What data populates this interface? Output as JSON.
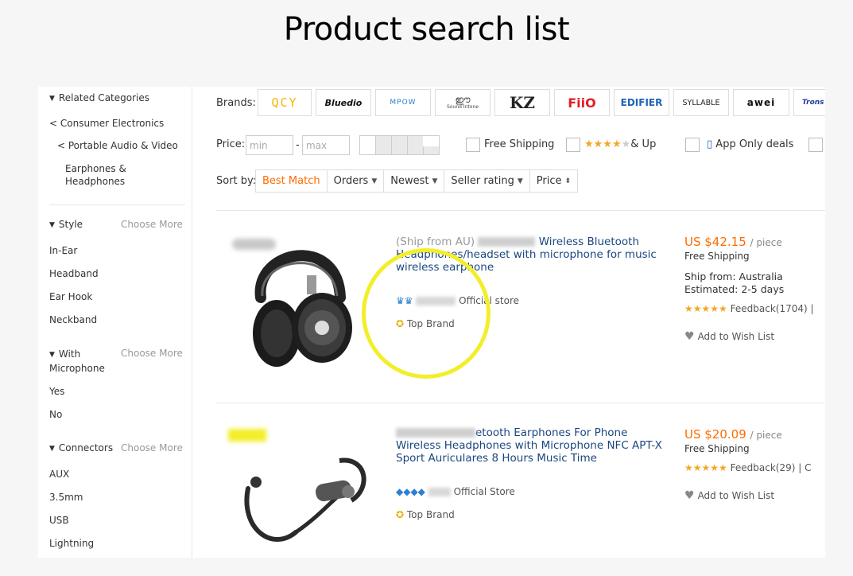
{
  "page_title": "Product search list",
  "sidebar": {
    "related_categories_heading": "Related Categories",
    "breadcrumb": [
      "< Consumer Electronics",
      "< Portable Audio & Video"
    ],
    "current_category": "Earphones & Headphones",
    "filter_groups": [
      {
        "title": "Style",
        "more": "Choose More",
        "options": [
          "In-Ear",
          "Headband",
          "Ear Hook",
          "Neckband"
        ]
      },
      {
        "title": "With Microphone",
        "more": "Choose More",
        "options": [
          "Yes",
          "No"
        ]
      },
      {
        "title": "Connectors",
        "more": "Choose More",
        "options": [
          "AUX",
          "3.5mm",
          "USB",
          "Lightning"
        ]
      }
    ]
  },
  "filters": {
    "brands_label": "Brands:",
    "brands": [
      "QCY",
      "Bluedio",
      "MPOW",
      "Sound Intone",
      "KZ",
      "FiiO",
      "EDIFIER",
      "SYLLABLE",
      "awei",
      "Trons"
    ],
    "price_label": "Price:",
    "price_min_placeholder": "min",
    "price_max_placeholder": "max",
    "price_sep": "-",
    "free_shipping": "Free Shipping",
    "rating_and_up": "& Up",
    "app_only": "App Only deals"
  },
  "sort": {
    "label": "Sort by:",
    "options": [
      "Best Match",
      "Orders",
      "Newest",
      "Seller rating",
      "Price"
    ],
    "active": "Best Match"
  },
  "products": [
    {
      "ship_prefix": "(Ship from AU)",
      "title_rest": "Wireless Bluetooth Headphones/headset with microphone for music wireless earphone",
      "store": "Official store",
      "badge": "Top Brand",
      "price": "US $42.15",
      "price_unit": "/ piece",
      "shipping": "Free Shipping",
      "ship_from": "Ship from: Australia",
      "estimated": "Estimated: 2-5 days",
      "feedback": "Feedback(1704)",
      "wish": "Add to Wish List"
    },
    {
      "title_rest": "etooth Earphones For Phone Wireless Headphones with Microphone NFC APT-X Sport Auriculares 8 Hours Music Time",
      "store": "Official Store",
      "badge": "Top Brand",
      "price": "US $20.09",
      "price_unit": "/ piece",
      "shipping": "Free Shipping",
      "feedback": "Feedback(29)",
      "wish": "Add to Wish List"
    }
  ],
  "colors": {
    "accent": "#ff6a00",
    "link": "#1a4780",
    "annotation": "#f3ee2a",
    "star": "#f5a623"
  }
}
